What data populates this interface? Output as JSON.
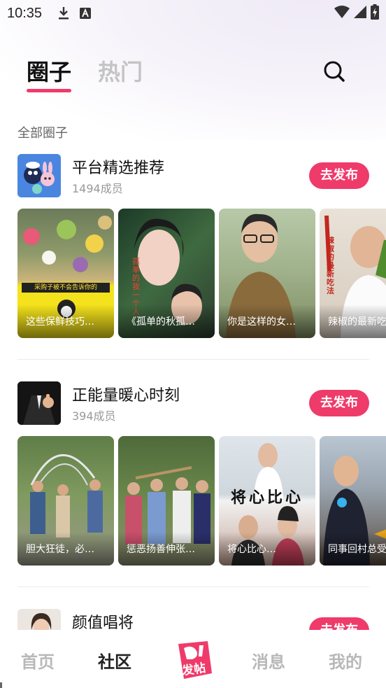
{
  "status_bar": {
    "time": "10:35"
  },
  "tabs": {
    "active": "圈子",
    "inactive": "热门"
  },
  "section_title": "全部圈子",
  "circles": [
    {
      "name": "平台精选推荐",
      "members": "1494成员",
      "button": "去发布",
      "thumbs": [
        {
          "caption": "这些保鲜技巧…",
          "overlay": "采购子被不会告诉你的"
        },
        {
          "caption": "《孤单的秋孤…",
          "overlay": "孤单的我一个人"
        },
        {
          "caption": "你是这样的女…",
          "overlay": ""
        },
        {
          "caption": "辣椒的最新吃…",
          "overlay": "辣椒的最新吃法"
        }
      ]
    },
    {
      "name": "正能量暖心时刻",
      "members": "394成员",
      "button": "去发布",
      "thumbs": [
        {
          "caption": "胆大狂徒，必…",
          "overlay": ""
        },
        {
          "caption": "惩恶扬善伸张…",
          "overlay": ""
        },
        {
          "caption": "将心比心…",
          "overlay": "将心比心"
        },
        {
          "caption": "同事回村总受…",
          "overlay": ""
        }
      ]
    },
    {
      "name": "颜值唱将",
      "members": "",
      "button": "去发布"
    }
  ],
  "bottom_nav": {
    "home": "首页",
    "community": "社区",
    "publish": "发帖",
    "messages": "消息",
    "mine": "我的"
  },
  "colors": {
    "accent": "#ef3b6a",
    "active_tab_underline": "#ef3b6a"
  }
}
